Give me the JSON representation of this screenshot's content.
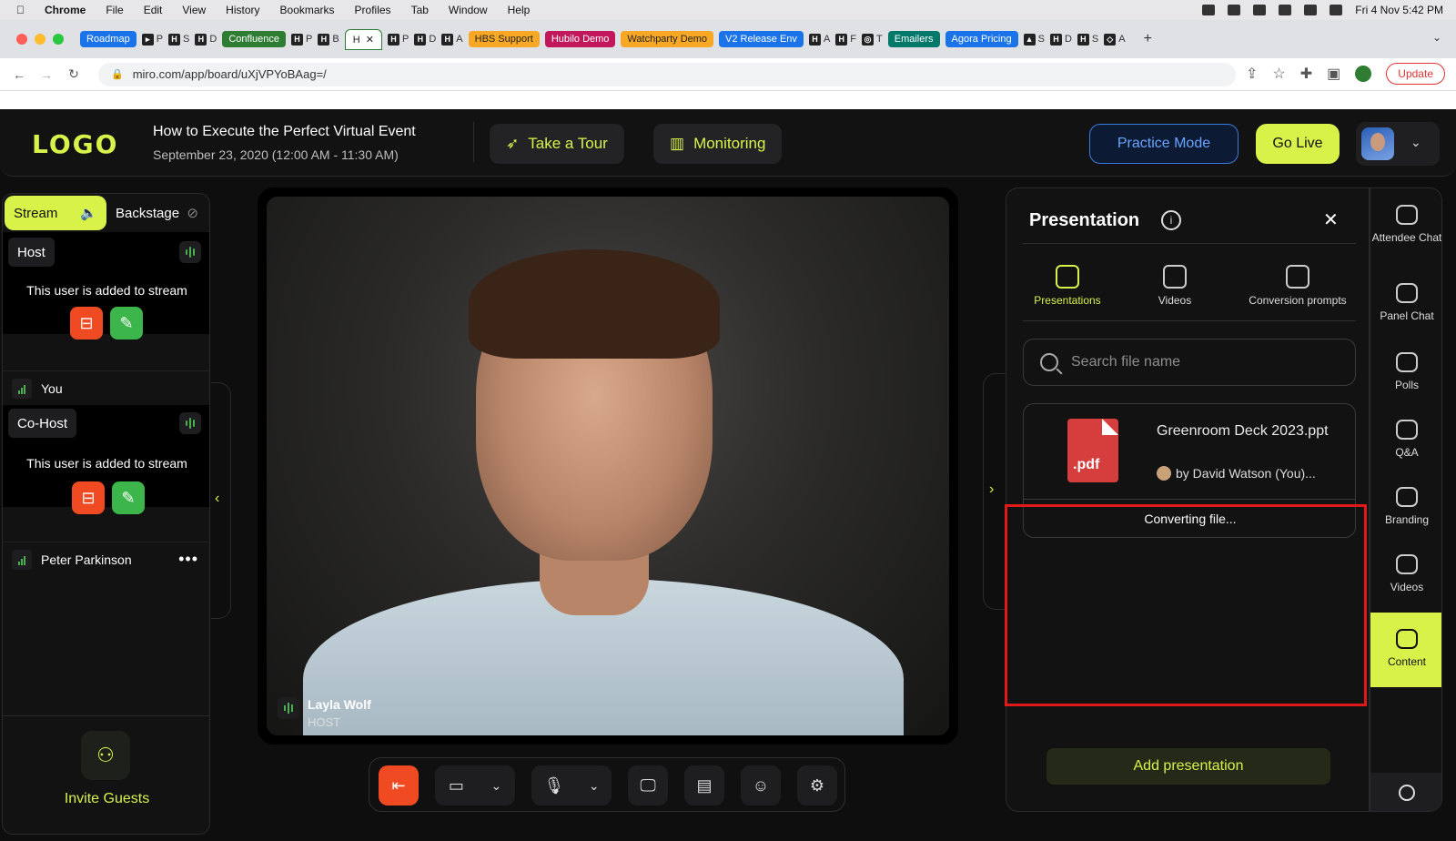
{
  "menubar": {
    "app": "Chrome",
    "items": [
      "File",
      "Edit",
      "View",
      "History",
      "Bookmarks",
      "Profiles",
      "Tab",
      "Window",
      "Help"
    ],
    "datetime": "Fri 4 Nov  5:42 PM"
  },
  "tabs": {
    "chips": [
      {
        "label": "Roadmap",
        "color": "#1a73e8"
      },
      {
        "label": "Confluence",
        "color": "#2e7d32"
      },
      {
        "label": "HBS Support",
        "color": "#f9a825"
      },
      {
        "label": "Hubilo Demo",
        "color": "#c2185b"
      },
      {
        "label": "Watchparty Demo",
        "color": "#f9a825"
      },
      {
        "label": "V2 Release Env",
        "color": "#1a73e8"
      },
      {
        "label": "Emailers",
        "color": "#00796b"
      },
      {
        "label": "Agora Pricing",
        "color": "#1a73e8"
      }
    ],
    "mini": [
      "P",
      "S",
      "D",
      "P",
      "B",
      "P",
      "D",
      "A",
      "A",
      "F",
      "T",
      "S",
      "D",
      "S",
      "A"
    ],
    "active_label": "H"
  },
  "address": {
    "url": "miro.com/app/board/uXjVPYoBAag=/",
    "update_label": "Update"
  },
  "header": {
    "logo": "LOGO",
    "event_title": "How to Execute the Perfect Virtual Event",
    "event_date": "September 23, 2020 (12:00 AM - 11:30 AM)",
    "tour_label": "Take a Tour",
    "monitoring_label": "Monitoring",
    "practice_label": "Practice Mode",
    "golive_label": "Go Live"
  },
  "left_panel": {
    "stream_tab": "Stream",
    "backstage_tab": "Backstage",
    "host_role": "Host",
    "host_status": "This user is added to stream",
    "host_name": "You",
    "cohost_role": "Co-Host",
    "cohost_status": "This user is added to stream",
    "cohost_name": "Peter Parkinson",
    "invite_label": "Invite Guests"
  },
  "video": {
    "speaker_name": "Layla Wolf",
    "speaker_role": "HOST"
  },
  "presentation": {
    "title": "Presentation",
    "tabs": [
      "Presentations",
      "Videos",
      "Conversion prompts"
    ],
    "search_placeholder": "Search file name",
    "file": {
      "ext": ".pdf",
      "name": "Greenroom Deck 2023.ppt",
      "owner": "by David Watson (You)...",
      "status": "Converting file..."
    },
    "add_label": "Add presentation"
  },
  "rail": {
    "items": [
      "Attendee Chat",
      "Panel Chat",
      "Polls",
      "Q&A",
      "Branding",
      "Videos",
      "Content"
    ],
    "active": "Content"
  },
  "colors": {
    "accent": "#d9f24a",
    "danger": "#f04a23",
    "success": "#3cb54a",
    "highlight": "#e0191b"
  }
}
